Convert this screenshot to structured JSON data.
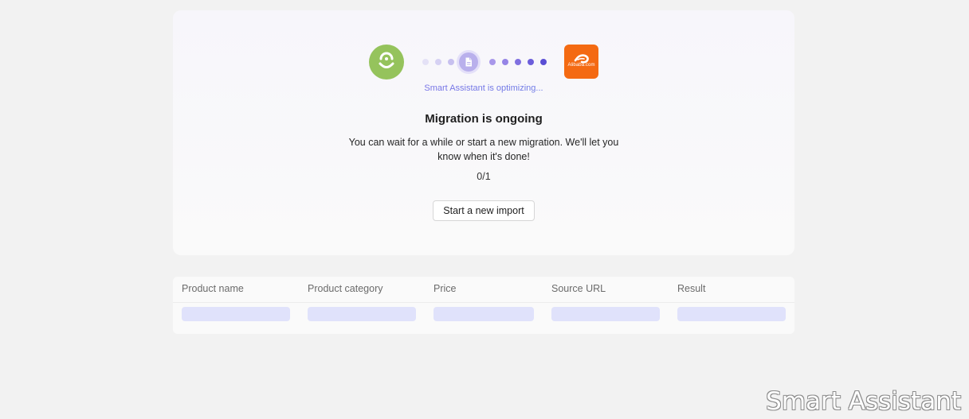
{
  "migration_card": {
    "source_platform_icon": "smiley-logo-icon",
    "target_platform_icon": "alibaba-logo-icon",
    "target_logo_text": "Alibaba.com",
    "progress_icon": "document-icon",
    "assistant_status": "Smart Assistant is optimizing...",
    "title": "Migration is ongoing",
    "message": "You can wait for a while or start a new migration. We'll let you know when it's done!",
    "progress": "0/1",
    "start_button_label": "Start a new import"
  },
  "table": {
    "columns": [
      "Product name",
      "Product category",
      "Price",
      "Source URL",
      "Result"
    ]
  },
  "watermark": "Smart Assistant",
  "colors": {
    "source_logo": "#95c35c",
    "target_logo": "#f46a12",
    "accent_purple": "#7a6ae0",
    "skeleton": "#e0e2fb"
  }
}
